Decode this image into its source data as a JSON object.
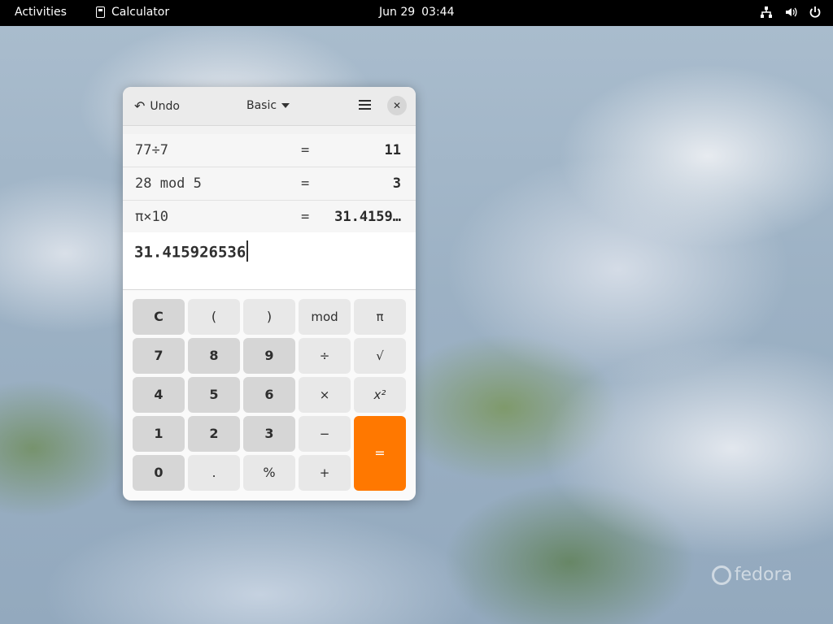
{
  "topbar": {
    "activities": "Activities",
    "app_name": "Calculator",
    "date": "Jun 29",
    "time": "03:44",
    "tray_icons": [
      "network-icon",
      "volume-icon",
      "power-icon"
    ]
  },
  "window": {
    "undo_label": "Undo",
    "mode_label": "Basic",
    "history": [
      {
        "expression": "77÷7",
        "equals": "=",
        "result": "11"
      },
      {
        "expression": "28 mod 5",
        "equals": "=",
        "result": "3"
      },
      {
        "expression": "π×10",
        "equals": "=",
        "result": "31.4159…"
      }
    ],
    "entry_value": "31.415926536",
    "keys": {
      "clear": "C",
      "lparen": "(",
      "rparen": ")",
      "mod": "mod",
      "pi": "π",
      "seven": "7",
      "eight": "8",
      "nine": "9",
      "divide": "÷",
      "sqrt": "√",
      "four": "4",
      "five": "5",
      "six": "6",
      "multiply": "×",
      "square": "x²",
      "one": "1",
      "two": "2",
      "three": "3",
      "subtract": "−",
      "equals": "=",
      "zero": "0",
      "point": ".",
      "percent": "%",
      "add": "+"
    }
  },
  "desktop": {
    "logo_text": "fedora"
  },
  "colors": {
    "accent": "#ff7800",
    "topbar": "#000000"
  }
}
